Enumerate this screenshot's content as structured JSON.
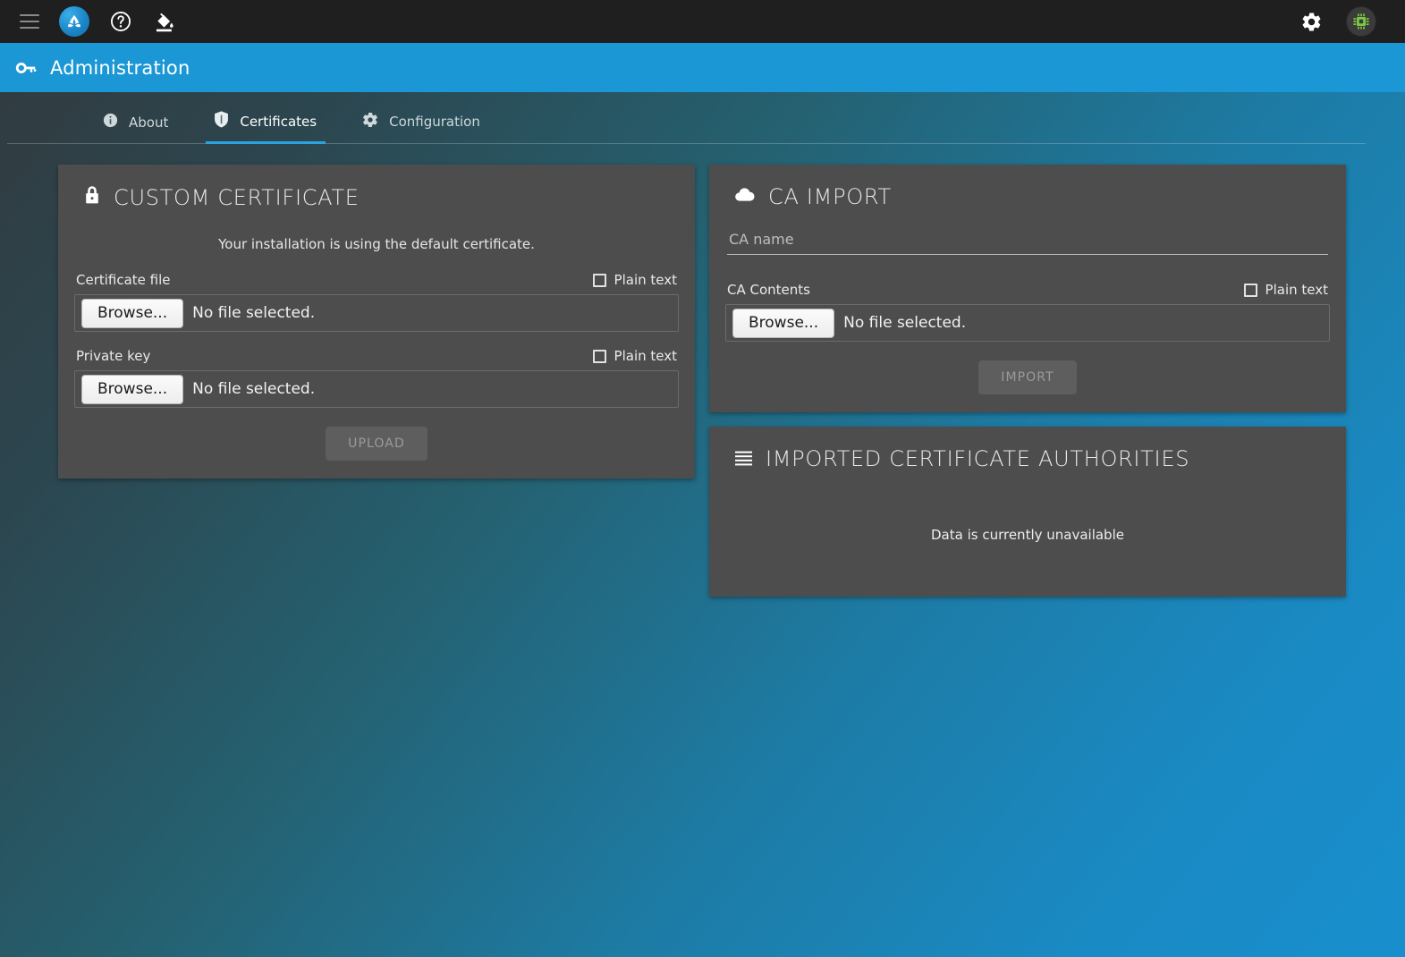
{
  "topbar": {
    "menu_icon": "hamburger-menu-icon",
    "brand_icon": "app-logo-icon",
    "help_icon": "help-circle-icon",
    "theme_icon": "paint-bucket-icon",
    "settings_icon": "gear-icon",
    "avatar_icon": "cpu-chip-avatar-icon",
    "accent_blue": "#1b97d5",
    "bar_bg": "#1f1f1f"
  },
  "page_header": {
    "icon": "key-icon",
    "title": "Administration"
  },
  "tabs": [
    {
      "id": "about",
      "label": "About",
      "icon": "info-circle-icon",
      "active": false
    },
    {
      "id": "certificates",
      "label": "Certificates",
      "icon": "shield-icon",
      "active": true
    },
    {
      "id": "configuration",
      "label": "Configuration",
      "icon": "gear-icon",
      "active": false
    }
  ],
  "custom_certificate": {
    "icon": "lock-icon",
    "title": "Custom Certificate",
    "notice": "Your installation is using the default certificate.",
    "certificate_file": {
      "label": "Certificate file",
      "plain_text_label": "Plain text",
      "plain_text_checked": false,
      "browse_label": "Browse...",
      "file_status": "No file selected."
    },
    "private_key": {
      "label": "Private key",
      "plain_text_label": "Plain text",
      "plain_text_checked": false,
      "browse_label": "Browse...",
      "file_status": "No file selected."
    },
    "upload_label": "UPLOAD",
    "upload_disabled": true
  },
  "ca_import": {
    "icon": "cloud-upload-icon",
    "title": "CA Import",
    "ca_name": {
      "value": "",
      "placeholder": "CA name"
    },
    "ca_contents": {
      "label": "CA Contents",
      "plain_text_label": "Plain text",
      "plain_text_checked": false,
      "browse_label": "Browse...",
      "file_status": "No file selected."
    },
    "import_label": "IMPORT",
    "import_disabled": true
  },
  "imported_cas": {
    "icon": "list-lines-icon",
    "title": "Imported Certificate Authorities",
    "empty_message": "Data is currently unavailable"
  }
}
